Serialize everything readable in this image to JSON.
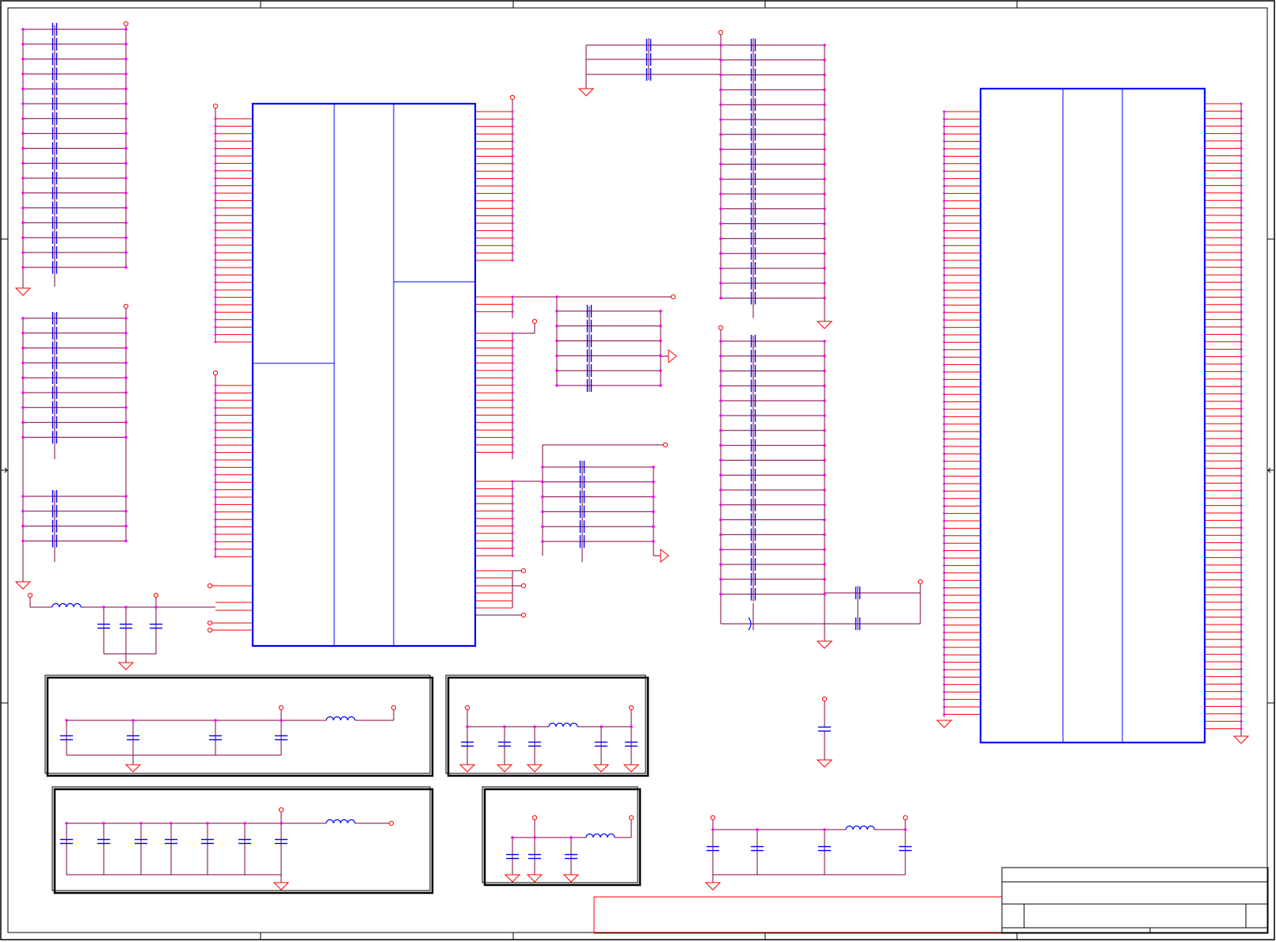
{
  "sheet": {
    "colors": {
      "border": "#000000",
      "ic_outline": "#0000ff",
      "wire": "#800040",
      "pin": "#ff0000",
      "node": "#ff00ff",
      "capacitor": "#0000ff",
      "inductor": "#0000ff",
      "ground": "#ff0000",
      "title_block": "#ff0000"
    },
    "symbols": {
      "ground": "ground-symbol",
      "power_port": "power-port-symbol",
      "capacitor": "capacitor-symbol",
      "inductor": "inductor-symbol",
      "junction": "junction-dot"
    }
  }
}
